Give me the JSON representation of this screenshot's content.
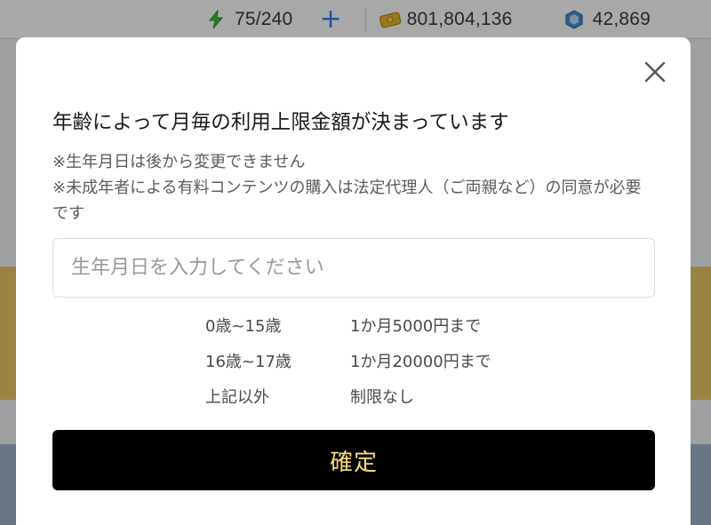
{
  "header": {
    "stamina": "75/240",
    "coins": "801,804,136",
    "gems": "42,869",
    "plus_symbol": "+"
  },
  "icons": {
    "stamina": "lightning-icon",
    "coins": "coin-stack-icon",
    "gems": "gem-icon",
    "add": "plus-icon",
    "close": "close-icon"
  },
  "colors": {
    "accent_blue": "#2f86e8",
    "stamina_green": "#3cbf3c",
    "coin_gold": "#e8b730",
    "gem_blue": "#4a8fd6",
    "confirm_bg": "#000000",
    "confirm_text": "#f7dc7a"
  },
  "modal": {
    "title": "年齢によって月毎の利用上限金額が決まっています",
    "note_1": "※生年月日は後から変更できません",
    "note_2": "※未成年者による有料コンテンツの購入は法定代理人（ご両親など）の同意が必要です",
    "birthdate_input": {
      "value": "",
      "placeholder": "生年月日を入力してください"
    },
    "limits": [
      {
        "age": "0歳~15歳",
        "limit": "1か月5000円まで"
      },
      {
        "age": "16歳~17歳",
        "limit": "1か月20000円まで"
      },
      {
        "age": "上記以外",
        "limit": "制限なし"
      }
    ],
    "confirm_label": "確定"
  }
}
